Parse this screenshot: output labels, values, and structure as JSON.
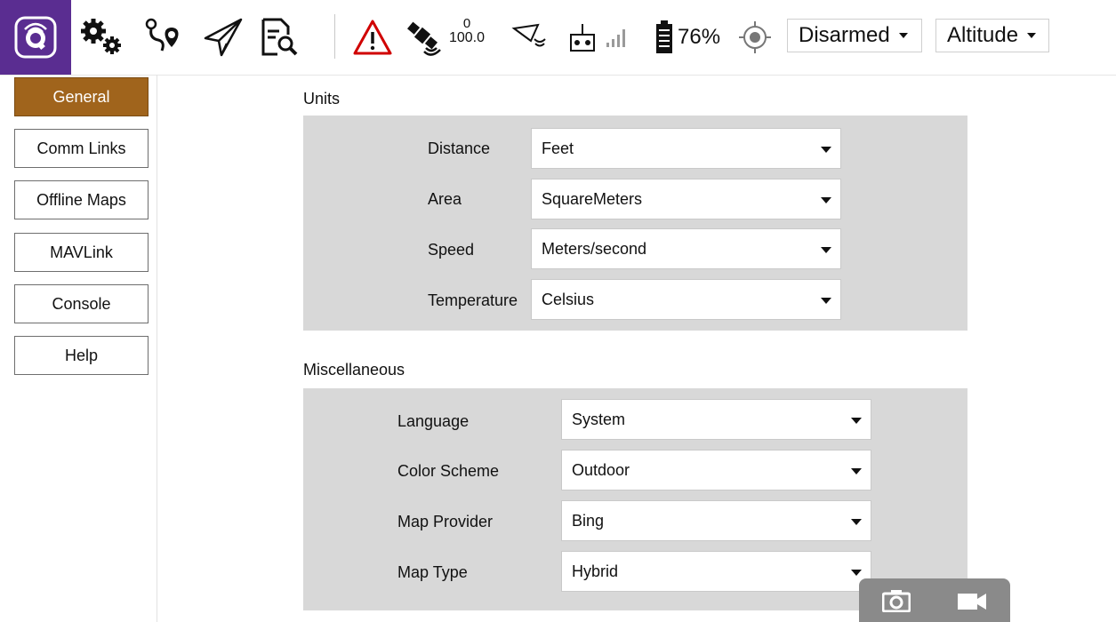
{
  "toolbar": {
    "gps_count": "0",
    "gps_hdop": "100.0",
    "battery_percent": "76%",
    "arm_state": "Disarmed",
    "flight_mode": "Altitude"
  },
  "sidebar": {
    "items": [
      {
        "label": "General",
        "active": true
      },
      {
        "label": "Comm Links"
      },
      {
        "label": "Offline Maps"
      },
      {
        "label": "MAVLink"
      },
      {
        "label": "Console"
      },
      {
        "label": "Help"
      }
    ]
  },
  "units": {
    "title": "Units",
    "rows": [
      {
        "label": "Distance",
        "value": "Feet"
      },
      {
        "label": "Area",
        "value": "SquareMeters"
      },
      {
        "label": "Speed",
        "value": "Meters/second"
      },
      {
        "label": "Temperature",
        "value": "Celsius"
      }
    ]
  },
  "misc": {
    "title": "Miscellaneous",
    "rows": [
      {
        "label": "Language",
        "value": "System"
      },
      {
        "label": "Color Scheme",
        "value": "Outdoor"
      },
      {
        "label": "Map Provider",
        "value": "Bing"
      },
      {
        "label": "Map Type",
        "value": "Hybrid"
      }
    ]
  },
  "colors": {
    "brand_purple": "#5a2d91",
    "active_nav": "#a0641c",
    "panel_gray": "#d8d8d8",
    "warning_red": "#d00000"
  }
}
